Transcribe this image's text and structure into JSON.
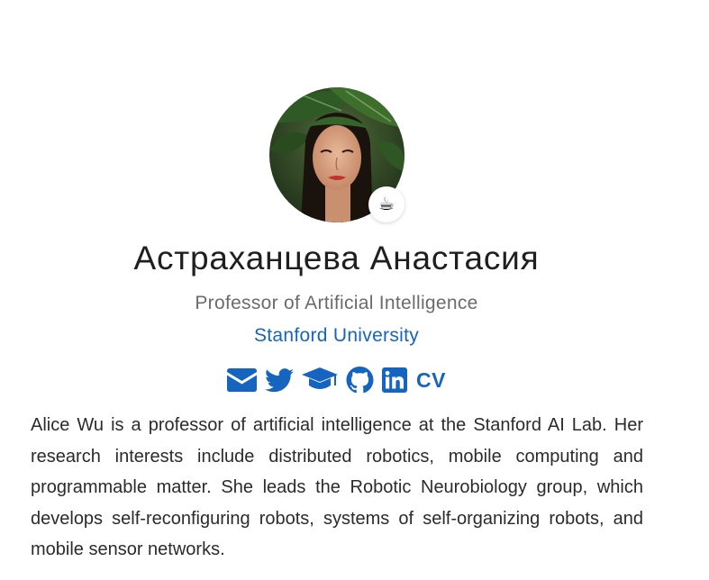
{
  "profile": {
    "name": "Астраханцева Анастасия",
    "role": "Professor of Artificial Intelligence",
    "organization": "Stanford University",
    "status_emoji": "☕",
    "bio": "Alice Wu is a professor of artificial intelligence at the Stanford AI Lab. Her research interests include distributed robotics, mobile computing and programmable matter. She leads the Robotic Neurobiology group, which develops self-reconfiguring robots, systems of self-organizing robots, and mobile sensor networks."
  },
  "socials": {
    "items": [
      {
        "icon": "envelope-icon"
      },
      {
        "icon": "twitter-icon"
      },
      {
        "icon": "graduation-cap-icon"
      },
      {
        "icon": "github-icon"
      },
      {
        "icon": "linkedin-icon"
      }
    ],
    "cv_label": "CV"
  },
  "colors": {
    "accent": "#1565c0",
    "name_text": "#1f1f1f",
    "role_text": "#6b6b6b",
    "body_text": "#2b2b2b"
  }
}
